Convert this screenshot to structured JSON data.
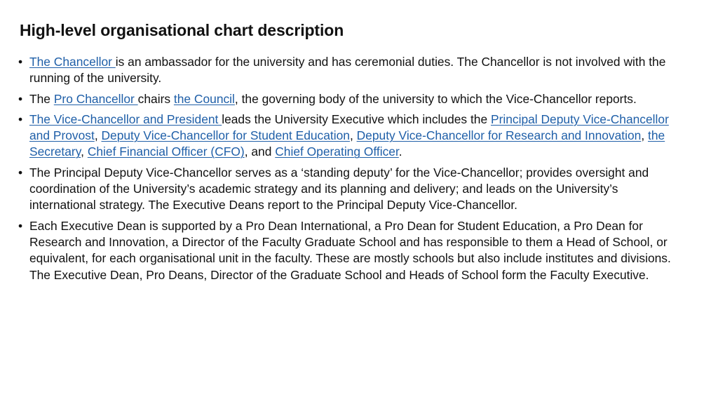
{
  "title": "High-level organisational chart description",
  "bullet_glyph": "•",
  "items": [
    {
      "segments": [
        {
          "type": "link",
          "text": "The Chancellor "
        },
        {
          "type": "text",
          "text": "is an ambassador for the university and has ceremonial duties. The Chancellor is not involved with the running of the university."
        }
      ]
    },
    {
      "segments": [
        {
          "type": "text",
          "text": "The "
        },
        {
          "type": "link",
          "text": "Pro Chancellor "
        },
        {
          "type": "text",
          "text": "chairs "
        },
        {
          "type": "link",
          "text": "the Council"
        },
        {
          "type": "text",
          "text": ", the governing body of the university to which the Vice-Chancellor reports."
        }
      ]
    },
    {
      "segments": [
        {
          "type": "link",
          "text": "The Vice-Chancellor and President "
        },
        {
          "type": "text",
          "text": "leads the University Executive which includes the "
        },
        {
          "type": "link",
          "text": "Principal Deputy Vice-Chancellor and Provost"
        },
        {
          "type": "text",
          "text": ", "
        },
        {
          "type": "link",
          "text": "Deputy Vice-Chancellor for Student Education"
        },
        {
          "type": "text",
          "text": ", "
        },
        {
          "type": "link",
          "text": "Deputy Vice-Chancellor for Research and Innovation"
        },
        {
          "type": "text",
          "text": ", "
        },
        {
          "type": "link",
          "text": "the Secretary"
        },
        {
          "type": "text",
          "text": ", "
        },
        {
          "type": "link",
          "text": "Chief Financial Officer (CFO)"
        },
        {
          "type": "text",
          "text": ", and "
        },
        {
          "type": "link",
          "text": "Chief Operating Officer"
        },
        {
          "type": "text",
          "text": "."
        }
      ]
    },
    {
      "segments": [
        {
          "type": "text",
          "text": "The Principal Deputy Vice-Chancellor serves as a ‘standing deputy’ for the Vice-Chancellor; provides oversight and coordination of the University’s academic strategy and its planning and delivery; and leads on the University’s international strategy. The Executive Deans report to the Principal Deputy Vice-Chancellor."
        }
      ]
    },
    {
      "segments": [
        {
          "type": "text",
          "text": "Each Executive Dean is supported by a Pro Dean International, a Pro Dean for Student Education, a Pro Dean for Research and Innovation, a Director of the Faculty Graduate School and has responsible to them a Head of School, or equivalent, for each organisational unit in the faculty. These are mostly schools but also include institutes and divisions. The Executive Dean, Pro Deans, Director of the Graduate School and Heads of School form the Faculty Executive."
        }
      ]
    }
  ]
}
